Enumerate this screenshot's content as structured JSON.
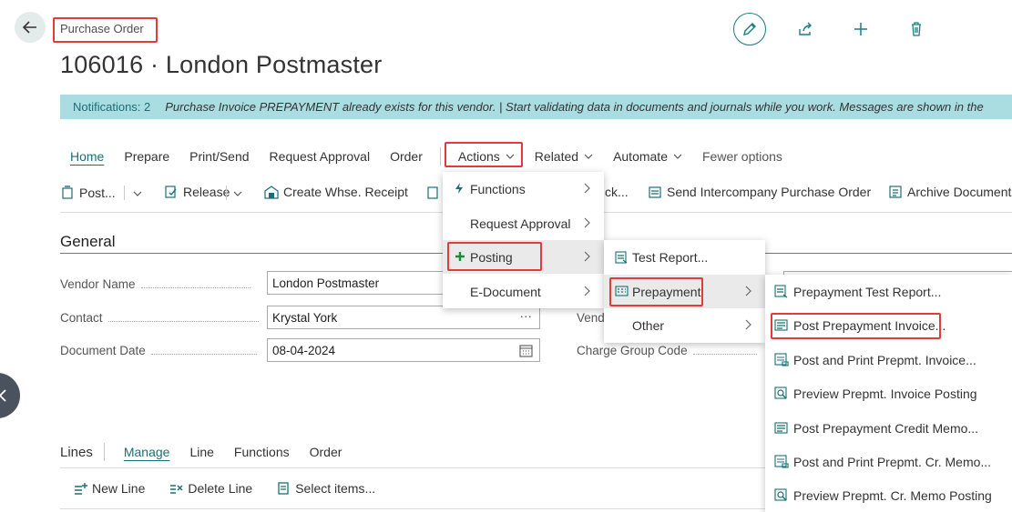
{
  "header": {
    "breadcrumb": "Purchase Order",
    "title": "106016 · London Postmaster"
  },
  "notification": {
    "count_label": "Notifications: 2",
    "message": "Purchase Invoice PREPAYMENT already exists for this vendor.  |  Start validating data in documents and journals while you work. Messages are shown in the"
  },
  "menu_bar": {
    "home": "Home",
    "prepare": "Prepare",
    "print_send": "Print/Send",
    "request_approval": "Request Approval",
    "order": "Order",
    "actions": "Actions",
    "related": "Related",
    "automate": "Automate",
    "fewer_options": "Fewer options"
  },
  "tool_bar": {
    "post": "Post...",
    "release": "Release",
    "create_whse_receipt": "Create Whse. Receipt",
    "ck": "ck...",
    "send_intercompany": "Send Intercompany Purchase Order",
    "archive_document": "Archive Document"
  },
  "general": {
    "title": "General",
    "vendor_name_label": "Vendor Name",
    "vendor_name_value": "London Postmaster",
    "contact_label": "Contact",
    "contact_value": "Krystal York",
    "document_date_label": "Document Date",
    "document_date_value": "08-04-2024",
    "vend_label": "Vend",
    "charge_group_label": "Charge Group Code"
  },
  "lines": {
    "title": "Lines",
    "manage": "Manage",
    "line": "Line",
    "functions": "Functions",
    "order": "Order",
    "new_line": "New Line",
    "delete_line": "Delete Line",
    "select_items": "Select items..."
  },
  "actions_menu": {
    "functions": "Functions",
    "request_approval": "Request Approval",
    "posting": "Posting",
    "e_document": "E-Document"
  },
  "posting_menu": {
    "test_report": "Test Report...",
    "prepayment": "Prepayment",
    "other": "Other"
  },
  "prepayment_menu": {
    "items": [
      "Prepayment Test Report...",
      "Post Prepayment Invoice...",
      "Post and Print Prepmt. Invoice...",
      "Preview Prepmt. Invoice Posting",
      "Post Prepayment Credit Memo...",
      "Post and Print Prepmt. Cr. Memo...",
      "Preview Prepmt. Cr. Memo Posting"
    ]
  },
  "colors": {
    "accent": "#1b6f74",
    "notification_bg": "#a9dde2",
    "highlight_box": "#e23b3b"
  }
}
